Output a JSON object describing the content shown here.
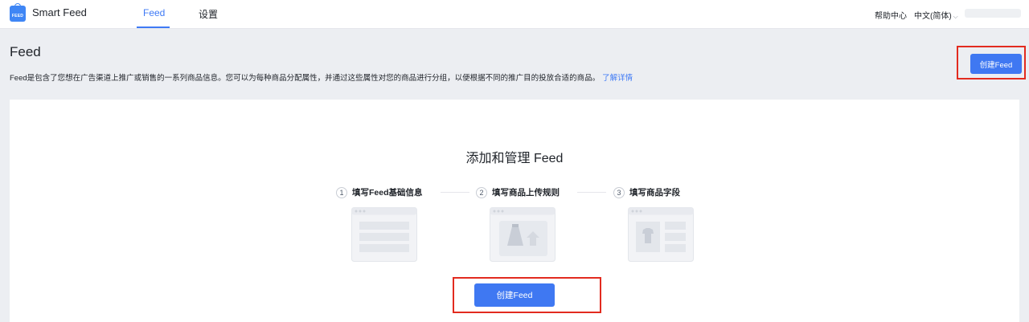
{
  "app": {
    "logo_text": "FEED",
    "name": "Smart Feed"
  },
  "nav": {
    "tabs": [
      {
        "label": "Feed",
        "active": true
      },
      {
        "label": "设置",
        "active": false
      }
    ],
    "help_label": "帮助中心",
    "language_label": "中文(简体)"
  },
  "header": {
    "title": "Feed",
    "description": "Feed是包含了您想在广告渠道上推广或销售的一系列商品信息。您可以为每种商品分配属性，并通过这些属性对您的商品进行分组，以便根据不同的推广目的投放合适的商品。",
    "learn_more": "了解详情",
    "create_button": "创建Feed"
  },
  "empty_state": {
    "title": "添加和管理 Feed",
    "steps": [
      {
        "number": "1",
        "label": "填写Feed基础信息",
        "icon": "form-layout-illustration"
      },
      {
        "number": "2",
        "label": "填写商品上传规则",
        "icon": "product-upload-illustration"
      },
      {
        "number": "3",
        "label": "填写商品字段",
        "icon": "product-fields-illustration"
      }
    ],
    "create_button": "创建Feed"
  },
  "colors": {
    "accent": "#3f78f2",
    "highlight": "#e22b1f",
    "page_bg": "#eceef2"
  }
}
